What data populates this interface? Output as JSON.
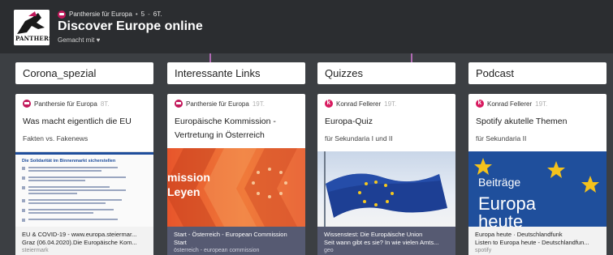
{
  "header": {
    "author": "Panthersie für Europa",
    "separator1": "•",
    "likes": "5",
    "separator2": "-",
    "age": "6T.",
    "title": "Discover Europe online",
    "made_with": "Gemacht mit ♥",
    "logo_text": "PANTHERS"
  },
  "columns": [
    {
      "title": "Corona_spezial",
      "card": {
        "author": "Panthersie für Europa",
        "age": "8T.",
        "title": "Was macht eigentlich die EU",
        "subtitle": "Fakten vs. Fakenews",
        "preview_heading": "Die Solidarität im Binnenmarkt sicherstellen",
        "link_title": "EU & COVID-19 - www.europa.steiermar...",
        "link_desc": "Graz (06.04.2020).Die Europäische Kom...",
        "link_source": "steiermark"
      }
    },
    {
      "title": "Interessante Links",
      "card": {
        "author": "Panthersie für Europa",
        "age": "19T.",
        "title": "Europäische Kommission - Vertretung in Österreich",
        "image_text_1": "mission",
        "image_text_2": "Leyen",
        "link_title": "Start - Österreich - European Commission",
        "link_desc": "Start",
        "link_source": "österreich - european commission"
      }
    },
    {
      "title": "Quizzes",
      "card": {
        "author": "Konrad Fellerer",
        "age": "19T.",
        "title": "Europa-Quiz",
        "subtitle": "für Sekundaria I und II",
        "link_title": "Wissenstest: Die Europäische Union",
        "link_desc": "Seit wann gibt es sie? In wie vielen Amts...",
        "link_source": "geo"
      }
    },
    {
      "title": "Podcast",
      "card": {
        "author": "Konrad Fellerer",
        "age": "19T.",
        "title": "Spotify akutelle Themen",
        "subtitle": "für Sekundaria II",
        "image_text_1": "Beiträge",
        "image_text_2": "Europa",
        "image_text_3": "heute",
        "link_title": "Europa heute · Deutschlandfunk",
        "link_desc": "Listen to Europa heute - Deutschlandfun...",
        "link_source": "spotify"
      }
    }
  ],
  "colors": {
    "background": "#3c3f43",
    "header": "#2b2d30",
    "accent": "#c2185b",
    "connector": "#b06ab3"
  }
}
